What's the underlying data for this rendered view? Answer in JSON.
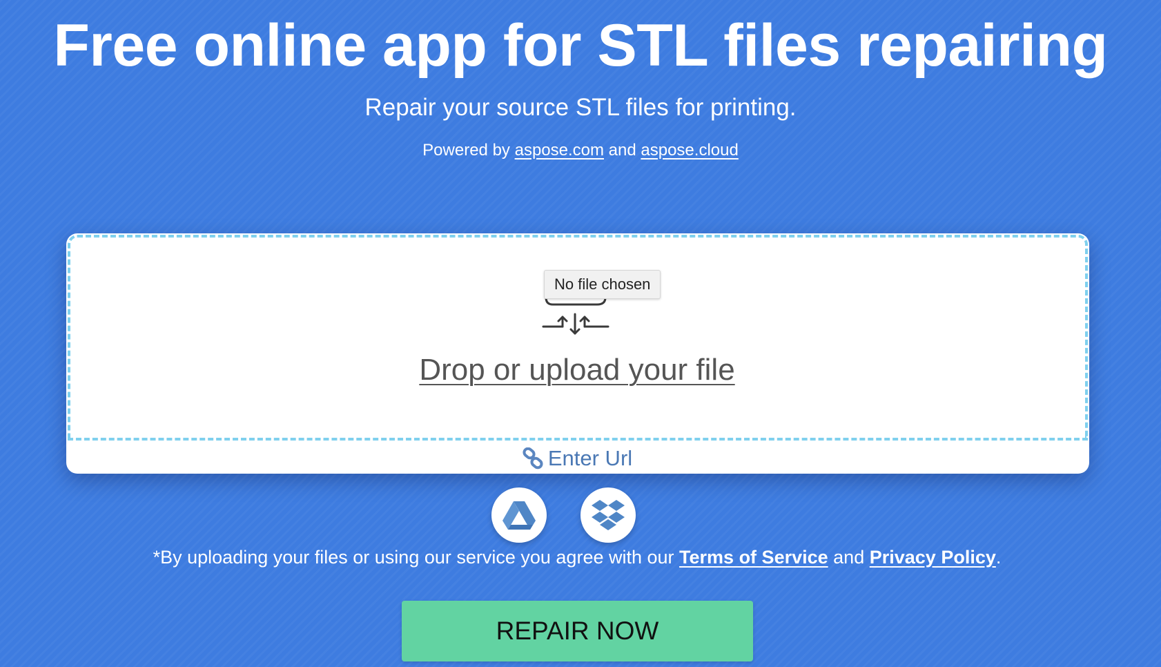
{
  "header": {
    "title": "Free online app for STL files repairing",
    "subtitle": "Repair your source STL files for printing.",
    "powered_prefix": "Powered by",
    "powered_link1": "aspose.com",
    "powered_and": "and",
    "powered_link2": "aspose.cloud"
  },
  "upload": {
    "tooltip": "No file chosen",
    "drop_label": "Drop or upload your file",
    "enter_url_label": "Enter Url",
    "icon": "cloud-upload-icon",
    "link_icon": "link-icon"
  },
  "cloud_sources": [
    {
      "name": "google-drive-icon"
    },
    {
      "name": "dropbox-icon"
    }
  ],
  "terms": {
    "prefix": "*By uploading your files or using our service you agree with our",
    "tos_label": "Terms of Service",
    "and": "and",
    "privacy_label": "Privacy Policy",
    "suffix": "."
  },
  "action": {
    "repair_label": "REPAIR NOW"
  },
  "colors": {
    "background": "#3e7ce0",
    "dropzone_border": "#7fd0ee",
    "repair_button": "#62d3a2",
    "link_blue": "#4a78b4"
  }
}
